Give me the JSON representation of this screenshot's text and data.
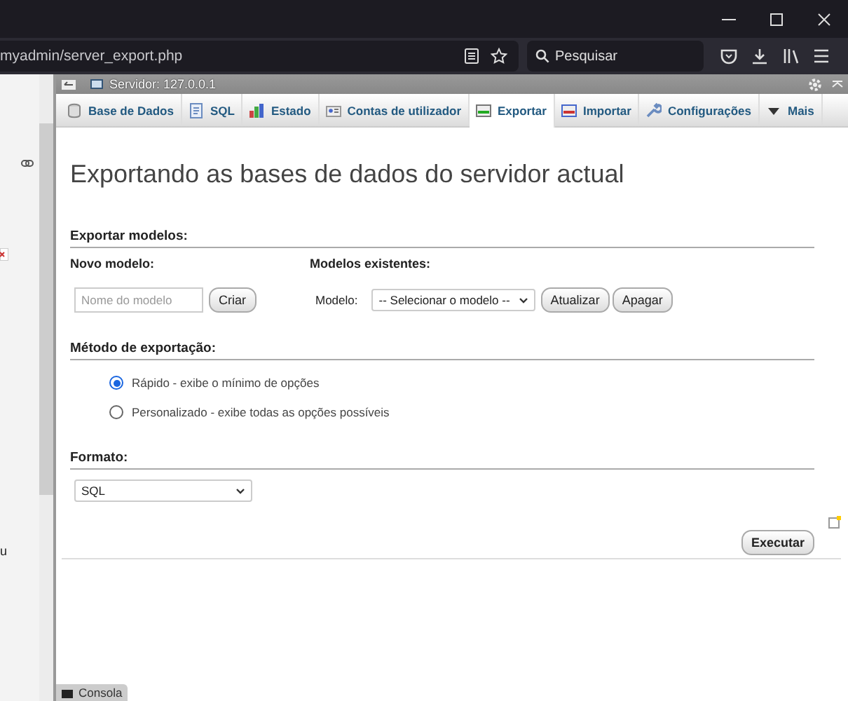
{
  "browser": {
    "url": "myadmin/server_export.php",
    "search_placeholder": "Pesquisar"
  },
  "sidebar": {
    "fragment": "u"
  },
  "server_bar": {
    "title": "Servidor: 127.0.0.1"
  },
  "tabs": [
    {
      "label": "Base de Dados",
      "selected": false
    },
    {
      "label": "SQL",
      "selected": false
    },
    {
      "label": "Estado",
      "selected": false
    },
    {
      "label": "Contas de utilizador",
      "selected": false
    },
    {
      "label": "Exportar",
      "selected": true
    },
    {
      "label": "Importar",
      "selected": false
    },
    {
      "label": "Configurações",
      "selected": false
    },
    {
      "label": "Mais",
      "selected": false
    }
  ],
  "heading": "Exportando as bases de dados do servidor actual",
  "templates": {
    "title": "Exportar modelos:",
    "new_label": "Novo modelo:",
    "name_placeholder": "Nome do modelo",
    "create_button": "Criar",
    "existing_label": "Modelos existentes:",
    "model_label": "Modelo:",
    "model_select": "-- Selecionar o modelo --",
    "update_button": "Atualizar",
    "delete_button": "Apagar"
  },
  "method": {
    "title": "Método de exportação:",
    "options": [
      {
        "label": "Rápido - exibe o mínimo de opções",
        "selected": true
      },
      {
        "label": "Personalizado - exibe todas as opções possíveis",
        "selected": false
      }
    ]
  },
  "format": {
    "title": "Formato:",
    "value": "SQL"
  },
  "execute_button": "Executar",
  "console": "Consola"
}
